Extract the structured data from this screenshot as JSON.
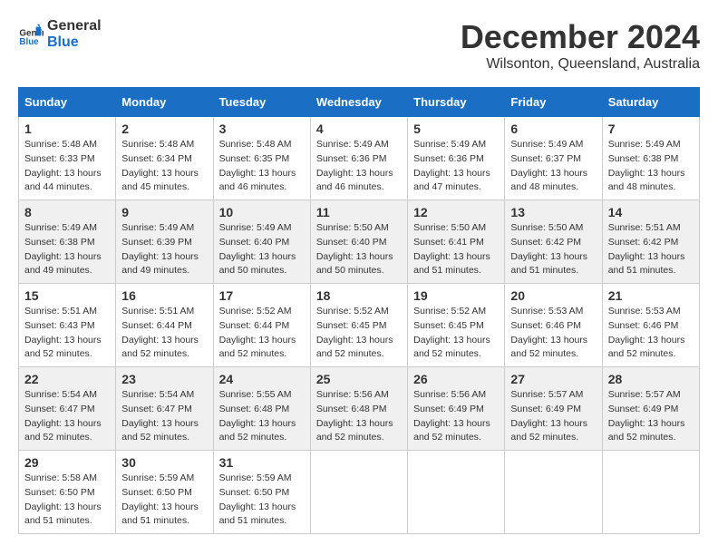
{
  "header": {
    "logo_line1": "General",
    "logo_line2": "Blue",
    "month": "December 2024",
    "location": "Wilsonton, Queensland, Australia"
  },
  "weekdays": [
    "Sunday",
    "Monday",
    "Tuesday",
    "Wednesday",
    "Thursday",
    "Friday",
    "Saturday"
  ],
  "weeks": [
    [
      {
        "day": "1",
        "sunrise": "5:48 AM",
        "sunset": "6:33 PM",
        "daylight": "13 hours and 44 minutes."
      },
      {
        "day": "2",
        "sunrise": "5:48 AM",
        "sunset": "6:34 PM",
        "daylight": "13 hours and 45 minutes."
      },
      {
        "day": "3",
        "sunrise": "5:48 AM",
        "sunset": "6:35 PM",
        "daylight": "13 hours and 46 minutes."
      },
      {
        "day": "4",
        "sunrise": "5:49 AM",
        "sunset": "6:36 PM",
        "daylight": "13 hours and 46 minutes."
      },
      {
        "day": "5",
        "sunrise": "5:49 AM",
        "sunset": "6:36 PM",
        "daylight": "13 hours and 47 minutes."
      },
      {
        "day": "6",
        "sunrise": "5:49 AM",
        "sunset": "6:37 PM",
        "daylight": "13 hours and 48 minutes."
      },
      {
        "day": "7",
        "sunrise": "5:49 AM",
        "sunset": "6:38 PM",
        "daylight": "13 hours and 48 minutes."
      }
    ],
    [
      {
        "day": "8",
        "sunrise": "5:49 AM",
        "sunset": "6:38 PM",
        "daylight": "13 hours and 49 minutes."
      },
      {
        "day": "9",
        "sunrise": "5:49 AM",
        "sunset": "6:39 PM",
        "daylight": "13 hours and 49 minutes."
      },
      {
        "day": "10",
        "sunrise": "5:49 AM",
        "sunset": "6:40 PM",
        "daylight": "13 hours and 50 minutes."
      },
      {
        "day": "11",
        "sunrise": "5:50 AM",
        "sunset": "6:40 PM",
        "daylight": "13 hours and 50 minutes."
      },
      {
        "day": "12",
        "sunrise": "5:50 AM",
        "sunset": "6:41 PM",
        "daylight": "13 hours and 51 minutes."
      },
      {
        "day": "13",
        "sunrise": "5:50 AM",
        "sunset": "6:42 PM",
        "daylight": "13 hours and 51 minutes."
      },
      {
        "day": "14",
        "sunrise": "5:51 AM",
        "sunset": "6:42 PM",
        "daylight": "13 hours and 51 minutes."
      }
    ],
    [
      {
        "day": "15",
        "sunrise": "5:51 AM",
        "sunset": "6:43 PM",
        "daylight": "13 hours and 52 minutes."
      },
      {
        "day": "16",
        "sunrise": "5:51 AM",
        "sunset": "6:44 PM",
        "daylight": "13 hours and 52 minutes."
      },
      {
        "day": "17",
        "sunrise": "5:52 AM",
        "sunset": "6:44 PM",
        "daylight": "13 hours and 52 minutes."
      },
      {
        "day": "18",
        "sunrise": "5:52 AM",
        "sunset": "6:45 PM",
        "daylight": "13 hours and 52 minutes."
      },
      {
        "day": "19",
        "sunrise": "5:52 AM",
        "sunset": "6:45 PM",
        "daylight": "13 hours and 52 minutes."
      },
      {
        "day": "20",
        "sunrise": "5:53 AM",
        "sunset": "6:46 PM",
        "daylight": "13 hours and 52 minutes."
      },
      {
        "day": "21",
        "sunrise": "5:53 AM",
        "sunset": "6:46 PM",
        "daylight": "13 hours and 52 minutes."
      }
    ],
    [
      {
        "day": "22",
        "sunrise": "5:54 AM",
        "sunset": "6:47 PM",
        "daylight": "13 hours and 52 minutes."
      },
      {
        "day": "23",
        "sunrise": "5:54 AM",
        "sunset": "6:47 PM",
        "daylight": "13 hours and 52 minutes."
      },
      {
        "day": "24",
        "sunrise": "5:55 AM",
        "sunset": "6:48 PM",
        "daylight": "13 hours and 52 minutes."
      },
      {
        "day": "25",
        "sunrise": "5:56 AM",
        "sunset": "6:48 PM",
        "daylight": "13 hours and 52 minutes."
      },
      {
        "day": "26",
        "sunrise": "5:56 AM",
        "sunset": "6:49 PM",
        "daylight": "13 hours and 52 minutes."
      },
      {
        "day": "27",
        "sunrise": "5:57 AM",
        "sunset": "6:49 PM",
        "daylight": "13 hours and 52 minutes."
      },
      {
        "day": "28",
        "sunrise": "5:57 AM",
        "sunset": "6:49 PM",
        "daylight": "13 hours and 52 minutes."
      }
    ],
    [
      {
        "day": "29",
        "sunrise": "5:58 AM",
        "sunset": "6:50 PM",
        "daylight": "13 hours and 51 minutes."
      },
      {
        "day": "30",
        "sunrise": "5:59 AM",
        "sunset": "6:50 PM",
        "daylight": "13 hours and 51 minutes."
      },
      {
        "day": "31",
        "sunrise": "5:59 AM",
        "sunset": "6:50 PM",
        "daylight": "13 hours and 51 minutes."
      },
      null,
      null,
      null,
      null
    ]
  ]
}
